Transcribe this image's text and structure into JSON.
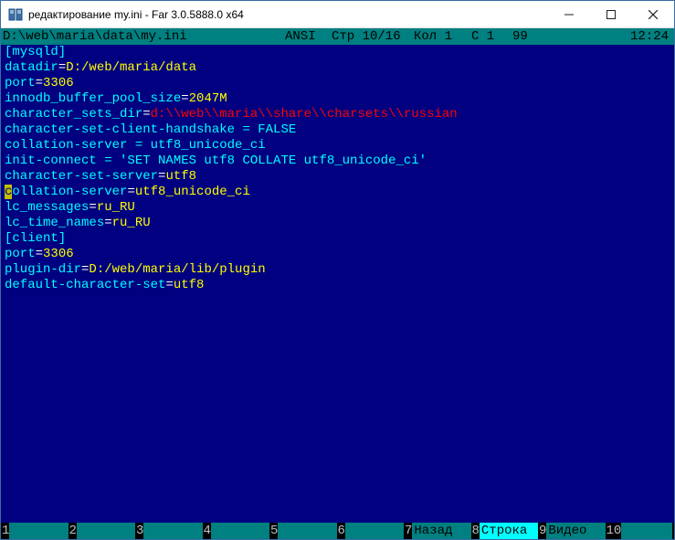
{
  "window": {
    "title": "редактирование my.ini - Far 3.0.5888.0 x64"
  },
  "status": {
    "filepath": "D:\\web\\maria\\data\\my.ini",
    "encoding": "ANSI",
    "line": "Стр 10/16",
    "col": "Кол 1",
    "chr": "С 1",
    "code": "99",
    "time": "12:24"
  },
  "editor": {
    "lines": [
      {
        "segs": [
          {
            "t": "[mysqld]",
            "c": ""
          }
        ]
      },
      {
        "segs": [
          {
            "t": "datadir",
            "c": ""
          },
          {
            "t": "=",
            "c": "w"
          },
          {
            "t": "D:/web/maria/data",
            "c": "v"
          }
        ]
      },
      {
        "segs": [
          {
            "t": "port",
            "c": ""
          },
          {
            "t": "=",
            "c": "w"
          },
          {
            "t": "3306",
            "c": "v"
          }
        ]
      },
      {
        "segs": [
          {
            "t": "innodb_buffer_pool_size",
            "c": ""
          },
          {
            "t": "=",
            "c": "w"
          },
          {
            "t": "2047M",
            "c": "v"
          }
        ]
      },
      {
        "segs": [
          {
            "t": "character_sets_dir",
            "c": ""
          },
          {
            "t": "=",
            "c": "w"
          },
          {
            "t": "d:\\\\web\\\\maria\\\\share\\\\charsets\\\\russian",
            "c": "s"
          }
        ]
      },
      {
        "segs": [
          {
            "t": "character-set-client-handshake = FALSE",
            "c": ""
          }
        ]
      },
      {
        "segs": [
          {
            "t": "collation-server = utf8_unicode_ci",
            "c": ""
          }
        ]
      },
      {
        "segs": [
          {
            "t": "init-connect = 'SET NAMES utf8 COLLATE utf8_unicode_ci'",
            "c": ""
          }
        ]
      },
      {
        "segs": [
          {
            "t": "character-set-server",
            "c": ""
          },
          {
            "t": "=",
            "c": "w"
          },
          {
            "t": "utf8",
            "c": "v"
          }
        ]
      },
      {
        "segs": [
          {
            "t": "c",
            "c": "hl-col"
          },
          {
            "t": "ollation-server",
            "c": ""
          },
          {
            "t": "=",
            "c": "w"
          },
          {
            "t": "utf8_unicode_ci",
            "c": "v"
          }
        ]
      },
      {
        "segs": [
          {
            "t": "lc_messages",
            "c": ""
          },
          {
            "t": "=",
            "c": "w"
          },
          {
            "t": "ru_RU",
            "c": "v"
          }
        ]
      },
      {
        "segs": [
          {
            "t": "lc_time_names",
            "c": ""
          },
          {
            "t": "=",
            "c": "w"
          },
          {
            "t": "ru_RU",
            "c": "v"
          }
        ]
      },
      {
        "segs": [
          {
            "t": "[client]",
            "c": ""
          }
        ]
      },
      {
        "segs": [
          {
            "t": "port",
            "c": ""
          },
          {
            "t": "=",
            "c": "w"
          },
          {
            "t": "3306",
            "c": "v"
          }
        ]
      },
      {
        "segs": [
          {
            "t": "plugin-dir",
            "c": ""
          },
          {
            "t": "=",
            "c": "w"
          },
          {
            "t": "D:/web/maria/lib/plugin",
            "c": "v"
          }
        ]
      },
      {
        "segs": [
          {
            "t": "default-character-set",
            "c": ""
          },
          {
            "t": "=",
            "c": "w"
          },
          {
            "t": "utf8",
            "c": "v"
          }
        ]
      }
    ]
  },
  "keybar": {
    "keys": [
      {
        "n": "1",
        "l": "     "
      },
      {
        "n": "2",
        "l": "     "
      },
      {
        "n": "3",
        "l": "     "
      },
      {
        "n": "4",
        "l": "     "
      },
      {
        "n": "5",
        "l": "     "
      },
      {
        "n": "6",
        "l": "     "
      },
      {
        "n": "7",
        "l": "Назад"
      },
      {
        "n": "8",
        "l": "Строка",
        "hl": true
      },
      {
        "n": "9",
        "l": "Видео"
      },
      {
        "n": "10",
        "l": "     "
      }
    ]
  }
}
